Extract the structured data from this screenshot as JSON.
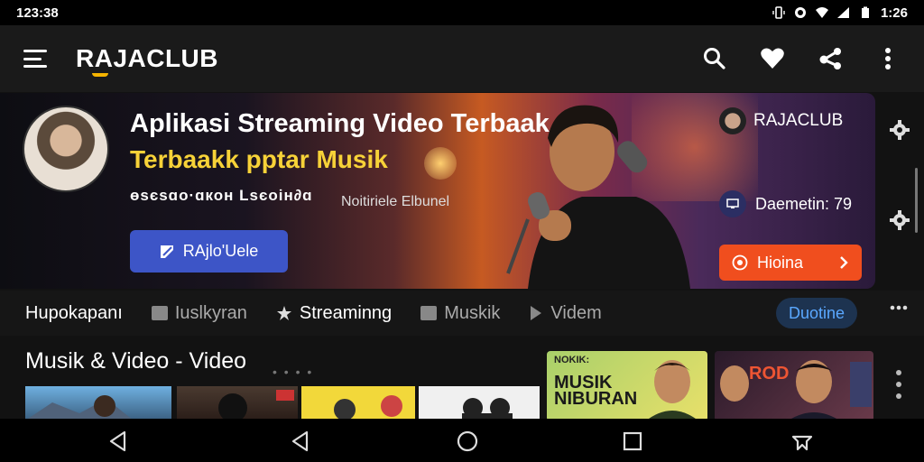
{
  "status_bar": {
    "time": "123:38",
    "clock_right": "1:26"
  },
  "app_bar": {
    "brand": "RAJACLUB",
    "actions": [
      "search-icon",
      "heart-icon",
      "share-icon",
      "more-vert-icon"
    ]
  },
  "banner": {
    "title": "Aplikasi Streaming Video Terbaak",
    "subtitle": "Terbaakk pptar Musik",
    "meta": "өѕєѕɑо·ɑкон Lѕєоін∂ɑ",
    "artist": "Noitiriele Elbunel",
    "button_label": "RAjlo'Uele",
    "side_brand": "RAJACLUB",
    "side_duration": "Daemetin: 79",
    "side_button": "Hioina"
  },
  "tabs": [
    {
      "label": "Hupokapanı",
      "icon": "",
      "active": true
    },
    {
      "label": "Iuslkyran",
      "icon": "list-icon",
      "active": false
    },
    {
      "label": "Streaminng",
      "icon": "star-icon",
      "active": true
    },
    {
      "label": "Muskik",
      "icon": "chat-icon",
      "active": false
    },
    {
      "label": "Videm",
      "icon": "play-icon",
      "active": false
    }
  ],
  "tab_pill": "Duotine",
  "section": {
    "title": "Musik & Video - Video"
  },
  "posters": [
    {
      "title": "NOKIK:",
      "headline": "MUSIK NIBURAN"
    },
    {
      "title": "ROD",
      "headline": ""
    }
  ],
  "colors": {
    "accent_blue": "#3d55c7",
    "accent_orange": "#f04e1e",
    "brand_yellow": "#f7d238",
    "pill_text": "#5aa8ff"
  }
}
